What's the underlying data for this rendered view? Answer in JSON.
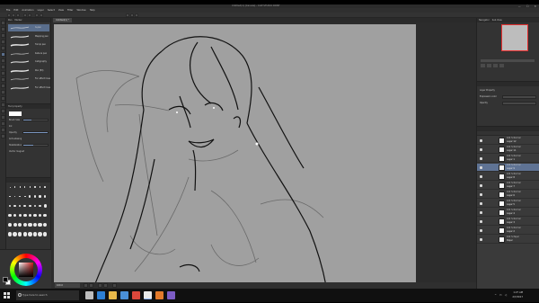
{
  "window": {
    "title": "Untitled(1) [Canvas] - CLIP STUDIO PAINT",
    "controls": [
      "—",
      "☐",
      "✕"
    ]
  },
  "menu": {
    "items": [
      "File",
      "Edit",
      "Animation",
      "Layer",
      "Select",
      "View",
      "Filter",
      "Window",
      "Help"
    ]
  },
  "subtool": {
    "tabs": [
      "Pen",
      "Marker"
    ],
    "brushes": [
      {
        "label": "G-pen",
        "selected": true
      },
      {
        "label": "Mapping pen",
        "selected": false
      },
      {
        "label": "Turnip pen",
        "selected": false
      },
      {
        "label": "Kabura pen",
        "selected": false
      },
      {
        "label": "Calligraphy",
        "selected": false
      },
      {
        "label": "Pen (fill)",
        "selected": false
      },
      {
        "label": "For effect lines",
        "selected": false
      },
      {
        "label": "For effect lines",
        "selected": false
      }
    ]
  },
  "tool_property": {
    "title": "Tool property",
    "rows": [
      "Brush Size",
      "Ink",
      "Opacity",
      "Anti-aliasing",
      "Stabilization",
      "Vector magnet"
    ],
    "brush_size_level": 0.35,
    "opacity_level": 1.0,
    "stabilization_level": 0.4
  },
  "document": {
    "tab_label": "Untitled(1) *",
    "zoom": "100.0"
  },
  "navigator": {
    "tabs": [
      "Navigator",
      "Sub View"
    ]
  },
  "layer_property": {
    "rows": [
      "Layer Property",
      "Expression color",
      "Opacity"
    ]
  },
  "layers": {
    "rows": [
      {
        "pct": "100 % Normal",
        "name": "Layer 12",
        "selected": false
      },
      {
        "pct": "100 % Normal",
        "name": "Layer 11",
        "selected": false
      },
      {
        "pct": "100 % Normal",
        "name": "Layer 1",
        "selected": false
      },
      {
        "pct": "100 % Normal",
        "name": "Layer 9",
        "selected": true
      },
      {
        "pct": "100 % Normal",
        "name": "Layer 8",
        "selected": false
      },
      {
        "pct": "100 % Normal",
        "name": "Layer 7",
        "selected": false
      },
      {
        "pct": "100 % Normal",
        "name": "Layer 6",
        "selected": false
      },
      {
        "pct": "100 % Normal",
        "name": "Layer 5",
        "selected": false
      },
      {
        "pct": "100 % Normal",
        "name": "Layer 4",
        "selected": false
      },
      {
        "pct": "100 % Normal",
        "name": "Layer 3",
        "selected": false
      },
      {
        "pct": "100 % Normal",
        "name": "Layer 2",
        "selected": false
      },
      {
        "pct": "100 % Paper",
        "name": "Paper",
        "selected": false
      }
    ]
  },
  "colors": {
    "main": "#000000",
    "sub": "#ffffff",
    "ui_bg": "#3b3b3b",
    "canvas": "#a0a0a0",
    "selection": "#5f7394"
  },
  "taskbar": {
    "search_placeholder": "Type here to search",
    "time": "1:27 AM",
    "date": "2/7/2017",
    "apps": [
      {
        "name": "task-view-icon",
        "color": "#bdbdbd"
      },
      {
        "name": "edge-icon",
        "color": "#2d7fd3"
      },
      {
        "name": "file-explorer-icon",
        "color": "#e8b84a"
      },
      {
        "name": "store-icon",
        "color": "#4a8fd6"
      },
      {
        "name": "chrome-icon",
        "color": "#d9473b"
      },
      {
        "name": "clip-studio-icon",
        "color": "#e9e9e9"
      },
      {
        "name": "firefox-icon",
        "color": "#e37a2b"
      },
      {
        "name": "media-icon",
        "color": "#7c5cc4"
      }
    ]
  }
}
